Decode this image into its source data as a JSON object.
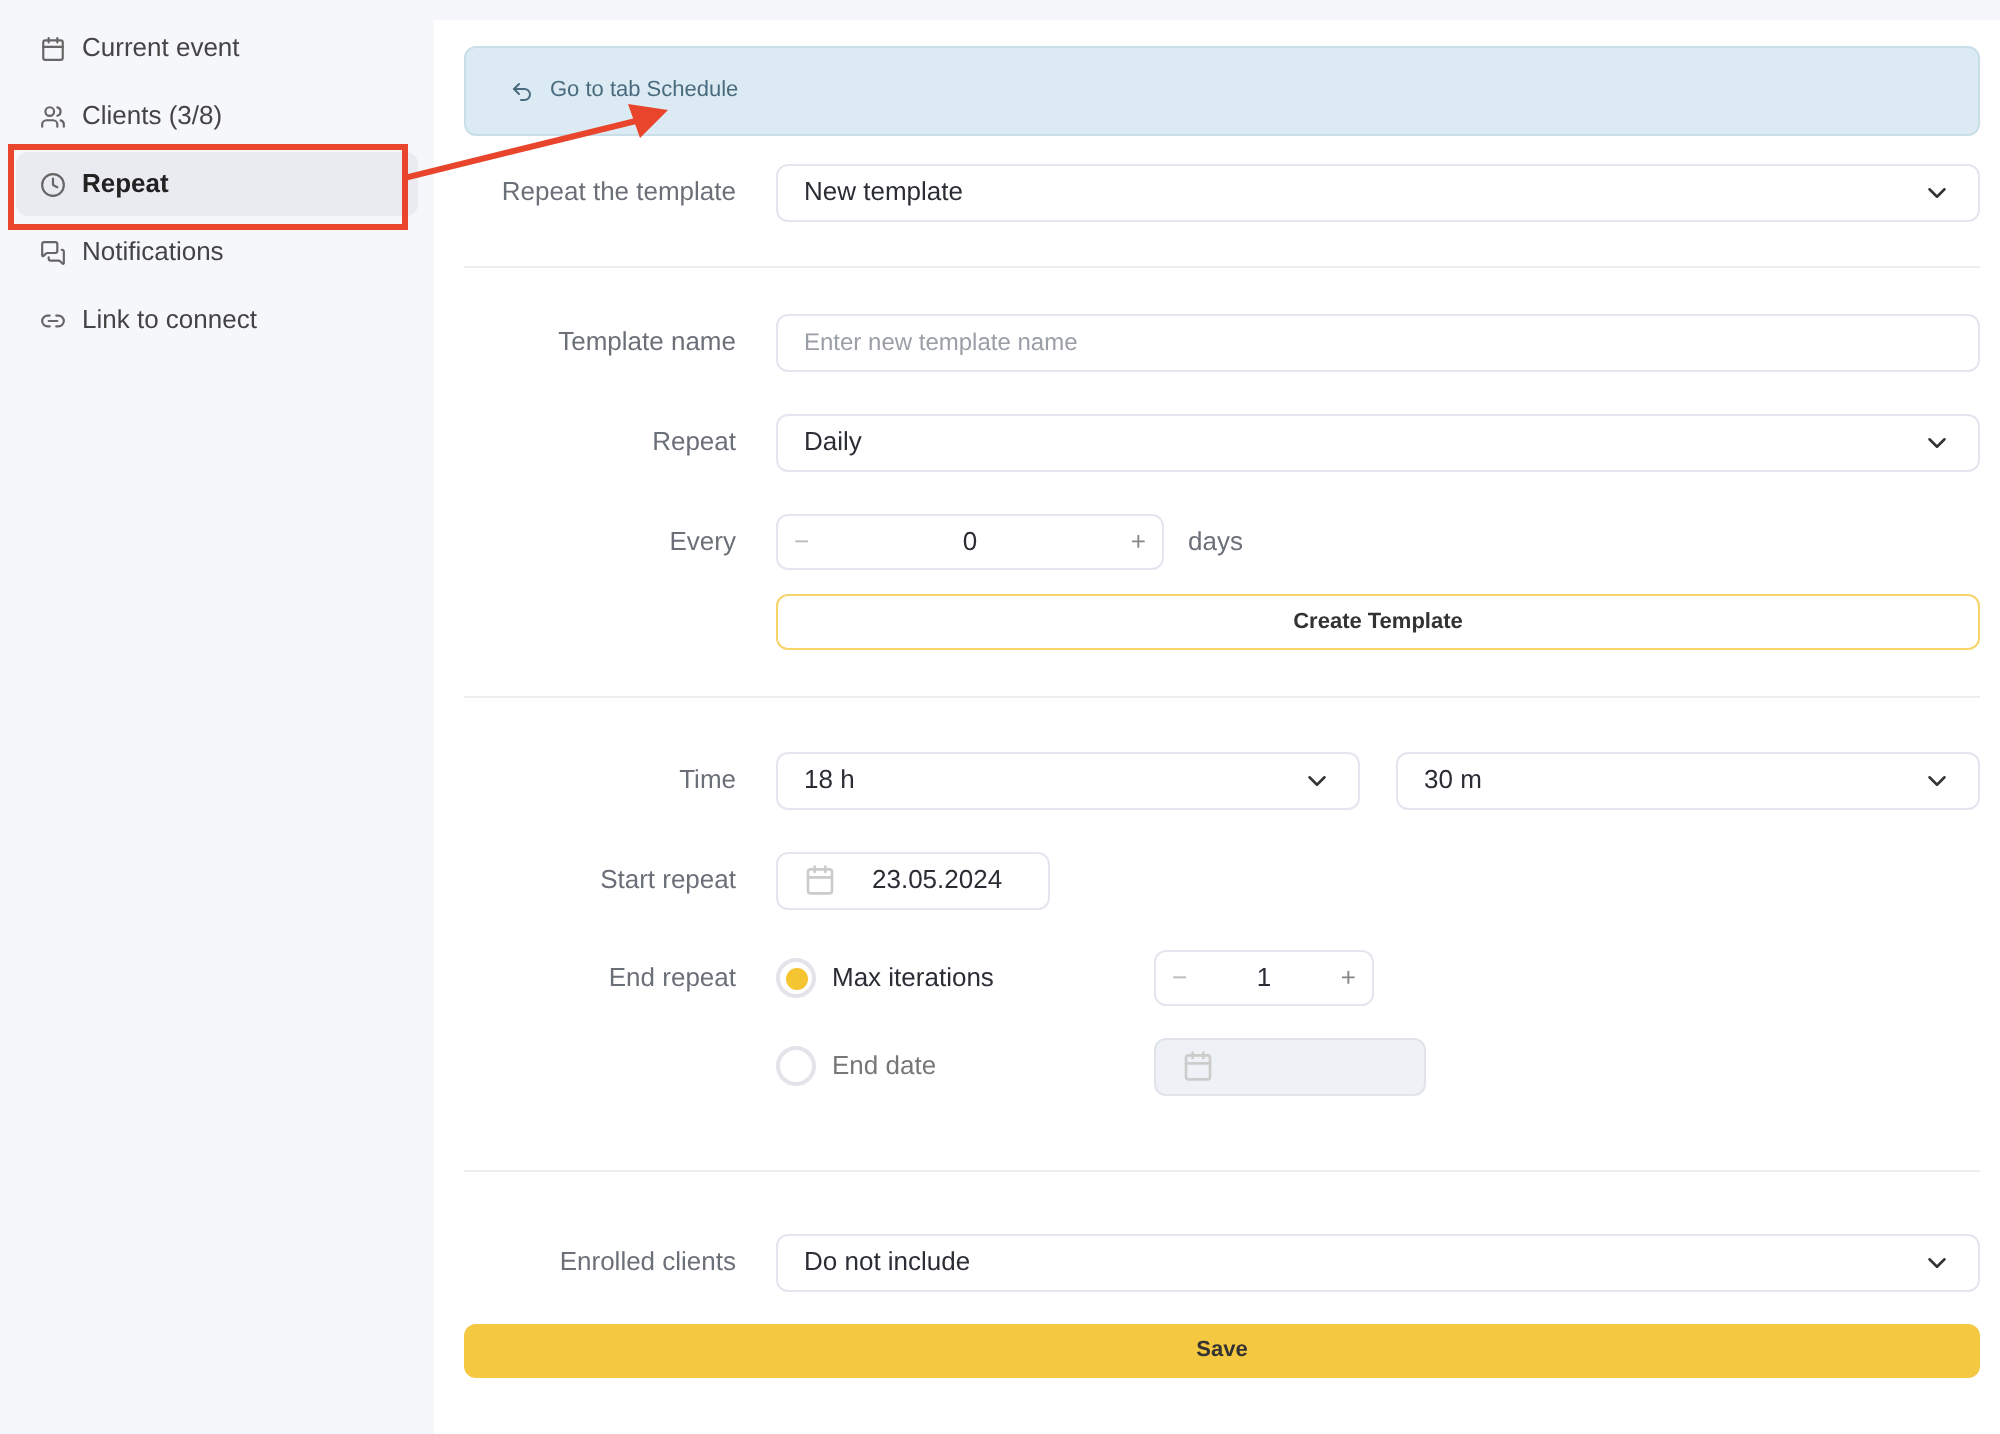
{
  "sidebar": {
    "items": [
      {
        "label": "Current event",
        "selected": false
      },
      {
        "label": "Clients (3/8)",
        "selected": false
      },
      {
        "label": "Repeat",
        "selected": true
      },
      {
        "label": "Notifications",
        "selected": false
      },
      {
        "label": "Link to connect",
        "selected": false
      }
    ]
  },
  "banner": {
    "text": "Go to tab Schedule"
  },
  "repeat_template": {
    "label": "Repeat the template",
    "value": "New template"
  },
  "template_name": {
    "label": "Template name",
    "placeholder": "Enter new template name"
  },
  "repeat": {
    "label": "Repeat",
    "value": "Daily"
  },
  "every": {
    "label": "Every",
    "minus": "−",
    "value": "0",
    "plus": "+",
    "unit": "days"
  },
  "create_button": "Create Template",
  "time": {
    "label": "Time",
    "hours": "18 h",
    "minutes": "30 m"
  },
  "start_repeat": {
    "label": "Start repeat",
    "value": "23.05.2024"
  },
  "end_repeat": {
    "label": "End repeat",
    "options": [
      {
        "label": "Max iterations",
        "selected": true,
        "kind": "stepper",
        "minus": "−",
        "value": "1",
        "plus": "+"
      },
      {
        "label": "End date",
        "selected": false,
        "kind": "date"
      }
    ]
  },
  "enrolled_clients": {
    "label": "Enrolled clients",
    "value": "Do not include"
  },
  "save_button": "Save"
}
